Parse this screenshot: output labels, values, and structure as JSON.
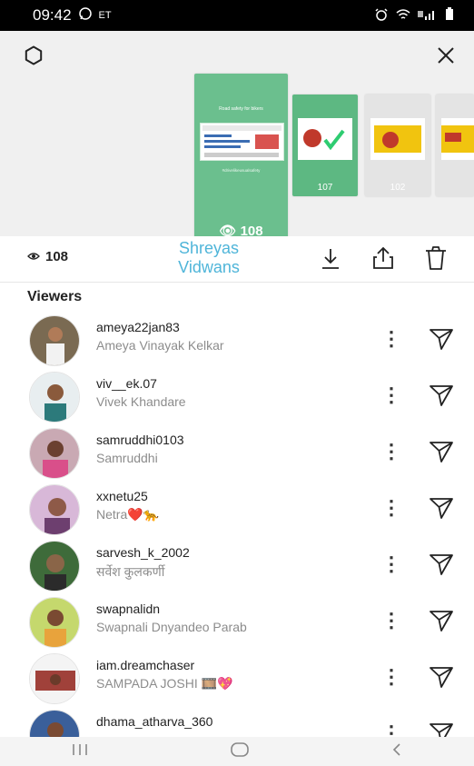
{
  "status_bar": {
    "time": "09:42",
    "carrier": "ET"
  },
  "story": {
    "main_thumb_title": "Road safety for bikers",
    "main_thumb_tag": "#drivelikeusualsafety",
    "main_count": "108",
    "thumb_counts": [
      "107",
      "102"
    ]
  },
  "actions": {
    "views": "108",
    "author": "Shreyas Vidwans"
  },
  "viewers_title": "Viewers",
  "viewers": [
    {
      "username": "ameya22jan83",
      "name": "Ameya Vinayak Kelkar"
    },
    {
      "username": "viv__ek.07",
      "name": "Vivek Khandare"
    },
    {
      "username": "samruddhi0103",
      "name": "Samruddhi"
    },
    {
      "username": "xxnetu25",
      "name": "Netra❤️🐆"
    },
    {
      "username": "sarvesh_k_2002",
      "name": "सर्वेश कुलकर्णी"
    },
    {
      "username": "swapnalidn",
      "name": "Swapnali Dnyandeo Parab"
    },
    {
      "username": "iam.dreamchaser",
      "name": "SAMPADA JOSHI 🎞️💖"
    },
    {
      "username": "dhama_atharva_360",
      "name": ""
    }
  ],
  "icons": {
    "settings": "settings-icon",
    "close": "close-icon",
    "download": "download-icon",
    "share": "share-icon",
    "delete": "trash-icon",
    "more": "more-vertical-icon",
    "send": "send-icon"
  },
  "colors": {
    "accent": "#4fb5d9",
    "story_green": "#6bbf8e"
  }
}
